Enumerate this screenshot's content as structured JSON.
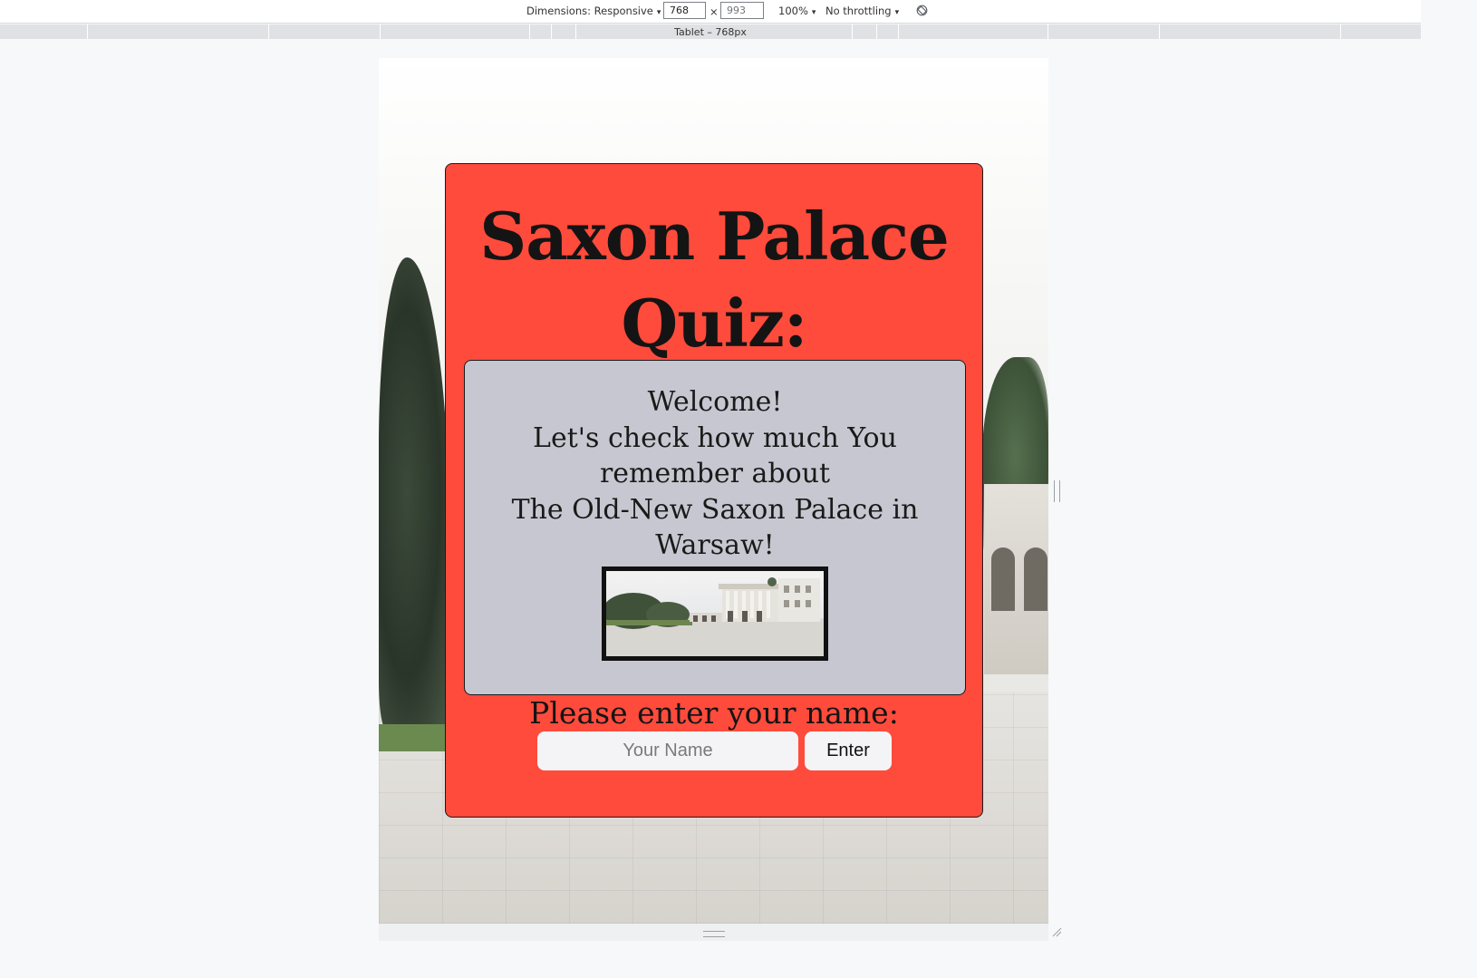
{
  "devtools": {
    "dimensions_label": "Dimensions: Responsive",
    "width_value": "768",
    "height_placeholder": "993",
    "times_sign": "×",
    "zoom_label": "100%",
    "throttle_label": "No throttling",
    "media_query_label": "Tablet – 768px",
    "rotate_icon": "rotate-icon",
    "caret_icon": "▾"
  },
  "quiz": {
    "title": "Saxon Palace Quiz:",
    "welcome_lines": [
      "Welcome!",
      "Let's check how much You remember about",
      "The Old-New Saxon Palace in Warsaw!"
    ],
    "prompt": "Please enter your name:",
    "name_placeholder": "Your Name",
    "name_value": "",
    "enter_label": "Enter"
  },
  "colors": {
    "card_background": "#ff4b3c",
    "welcome_box_background": "#c7c7d1",
    "input_background": "#f4f4f6"
  }
}
